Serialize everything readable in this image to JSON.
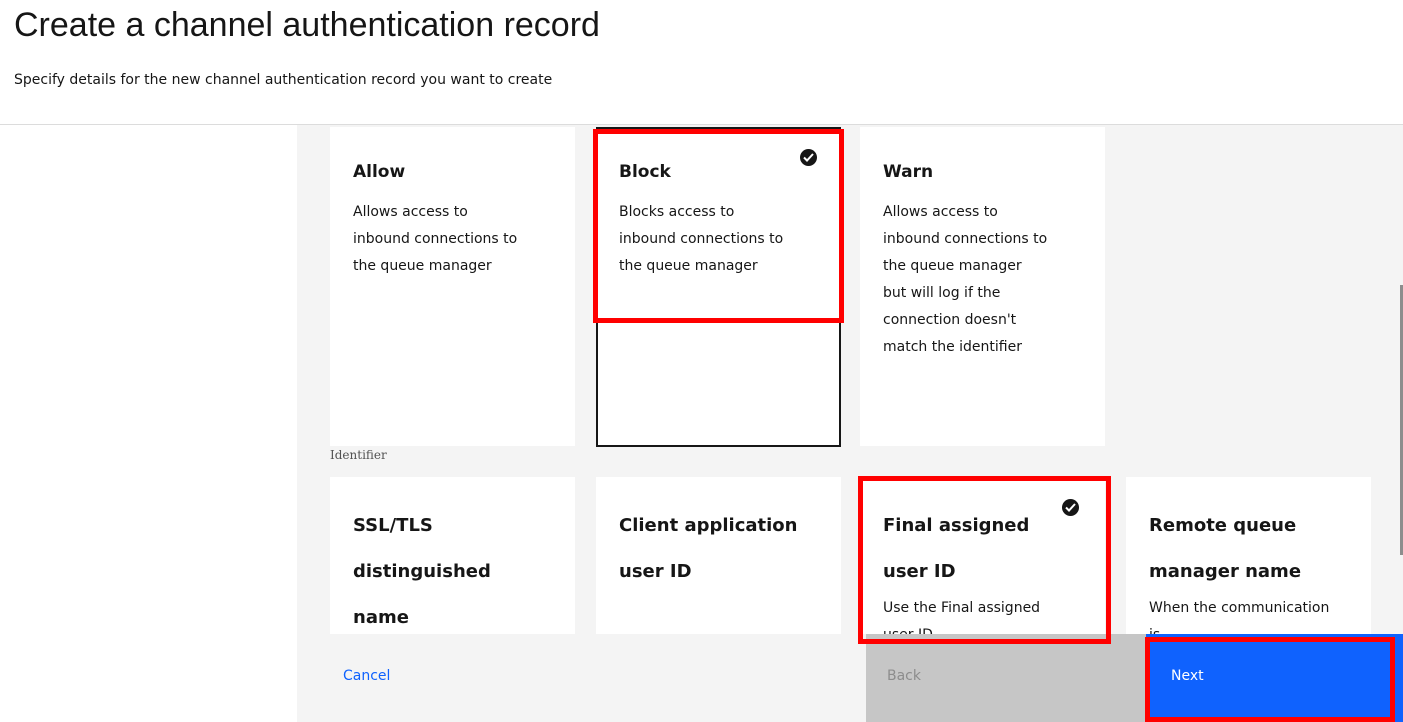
{
  "header": {
    "title": "Create a channel authentication record",
    "subtitle": "Specify details for the new channel authentication record you want to create"
  },
  "rule_types": [
    {
      "title": "Allow",
      "description": "Allows access to inbound connections to the queue manager",
      "selected": false
    },
    {
      "title": "Block",
      "description": "Blocks access to inbound connections to the queue manager",
      "selected": true
    },
    {
      "title": "Warn",
      "description": "Allows access to inbound connections to the queue manager but will log if the connection doesn't match the identifier",
      "selected": false
    }
  ],
  "identifier": {
    "label": "Identifier",
    "options": [
      {
        "title": "SSL/TLS distinguished name",
        "description": "",
        "selected": false
      },
      {
        "title": "Client application user ID",
        "description": "",
        "selected": false
      },
      {
        "title": "Final assigned user ID",
        "description": "Use the Final assigned user ID",
        "selected": true
      },
      {
        "title": "Remote queue manager name",
        "description": "When the communication is",
        "selected": false
      }
    ]
  },
  "footer": {
    "cancel_label": "Cancel",
    "back_label": "Back",
    "next_label": "Next"
  },
  "colors": {
    "primary": "#0f62fe",
    "highlight": "#ff0000",
    "disabled": "#c6c6c6"
  },
  "icons": {
    "selected": "checkmark-filled-icon"
  }
}
